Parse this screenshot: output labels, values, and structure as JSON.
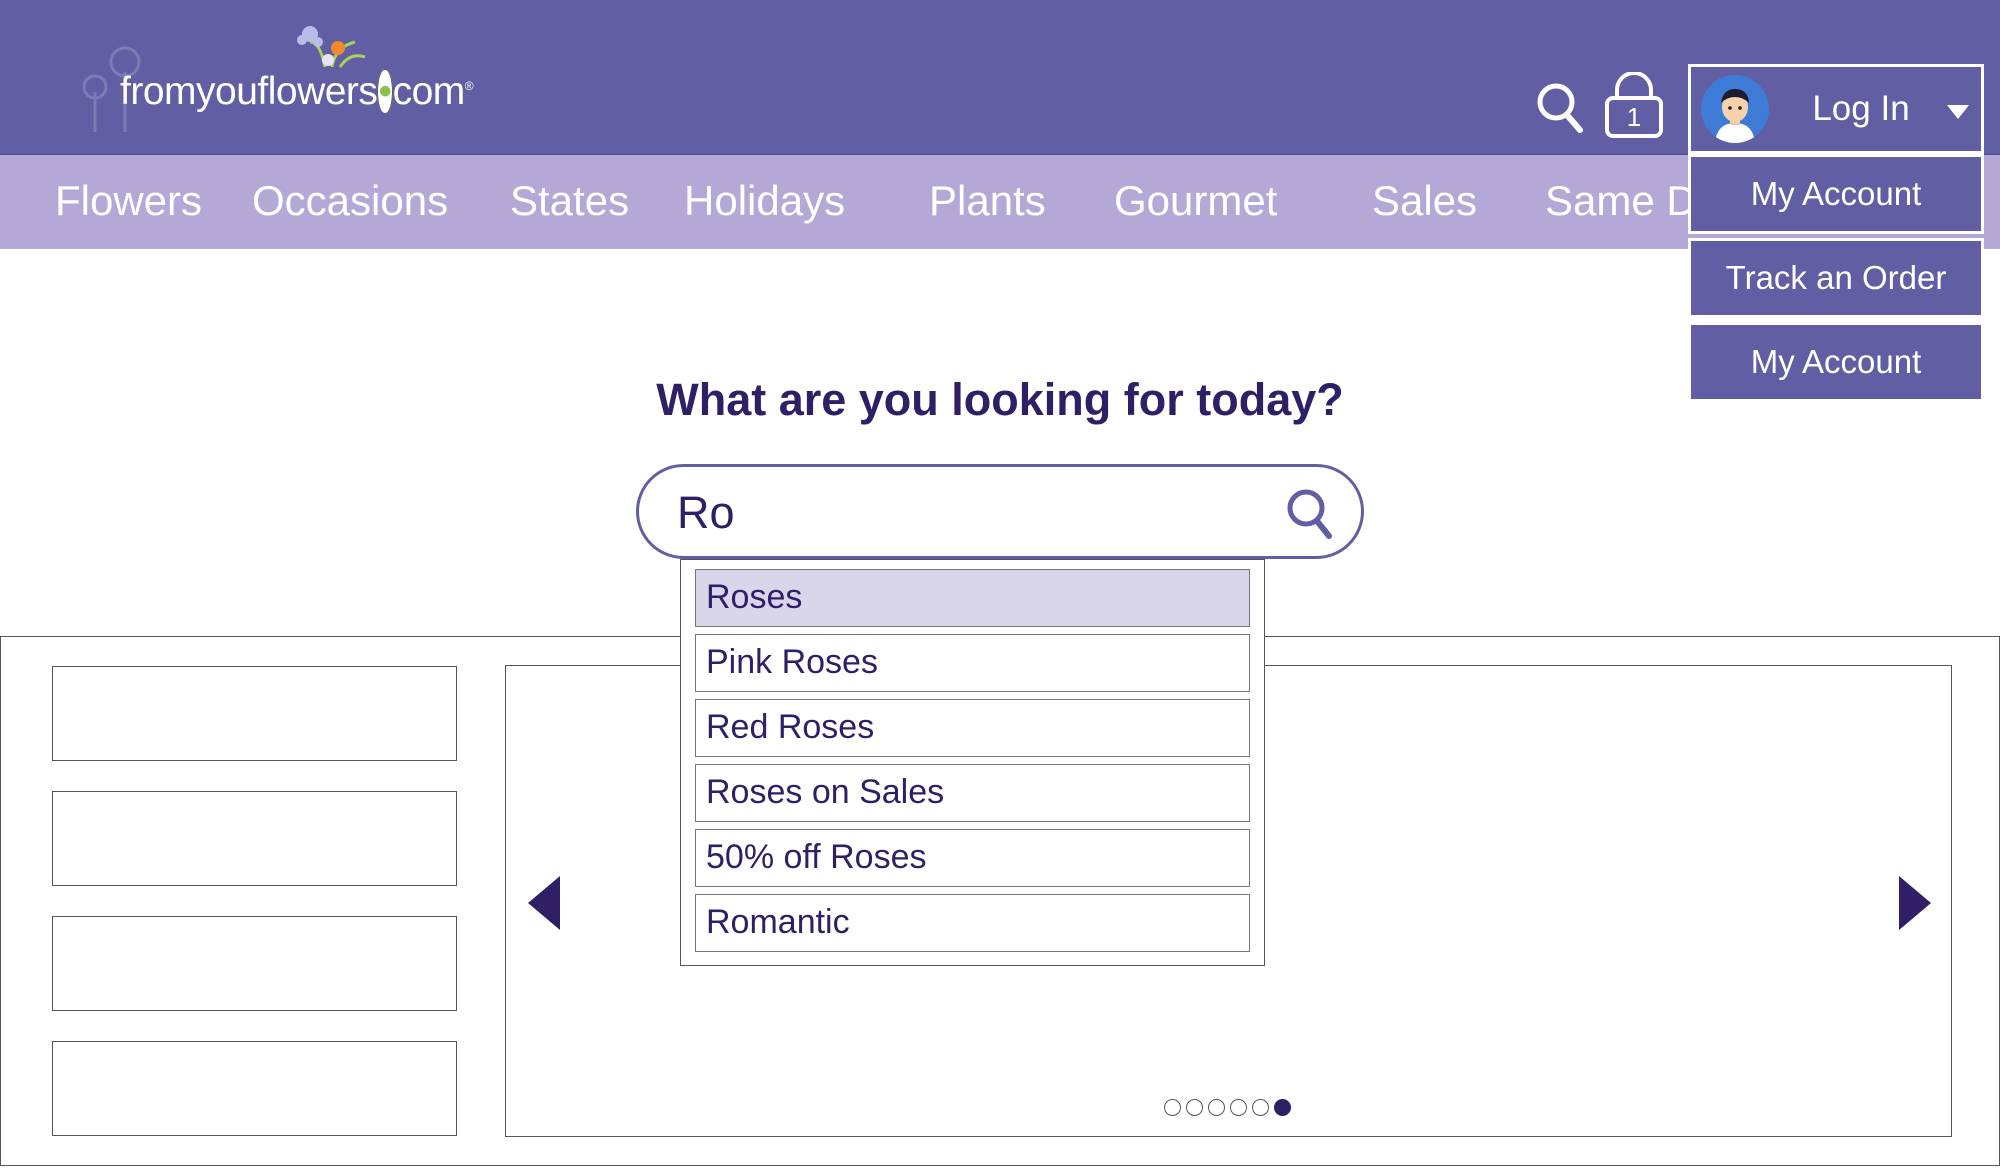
{
  "header": {
    "logo": {
      "name": "fromyouflowers",
      "dot": "•",
      "tld": "com",
      "mark": "®"
    },
    "search_icon": "search-icon",
    "cart": {
      "icon": "bag-icon",
      "count": "1"
    },
    "login": {
      "label": "Log In",
      "avatar_icon": "user-avatar-icon",
      "caret_icon": "caret-down-icon"
    }
  },
  "nav": {
    "items": [
      "Flowers",
      "Occasions",
      "States",
      "Holidays",
      "Plants",
      "Gourmet",
      "Sales",
      "Same D"
    ]
  },
  "account_menu": {
    "items": [
      "My Account",
      "Track an Order",
      "My Account"
    ]
  },
  "search": {
    "headline": "What are you looking for today?",
    "value": "Ro",
    "icon": "search-icon",
    "suggestions": [
      "Roses",
      "Pink Roses",
      "Red Roses",
      "Roses on Sales",
      "50% off Roses",
      "Romantic"
    ],
    "active_index": 0
  },
  "carousel": {
    "total_slides": 6,
    "active_slide": 6,
    "prev_icon": "arrow-left-icon",
    "next_icon": "arrow-right-icon"
  },
  "colors": {
    "header_bg": "#625ea3",
    "nav_bg": "#b3a8d6",
    "text_dark": "#2e1f66",
    "suggestion_active": "#d9d5ea"
  }
}
